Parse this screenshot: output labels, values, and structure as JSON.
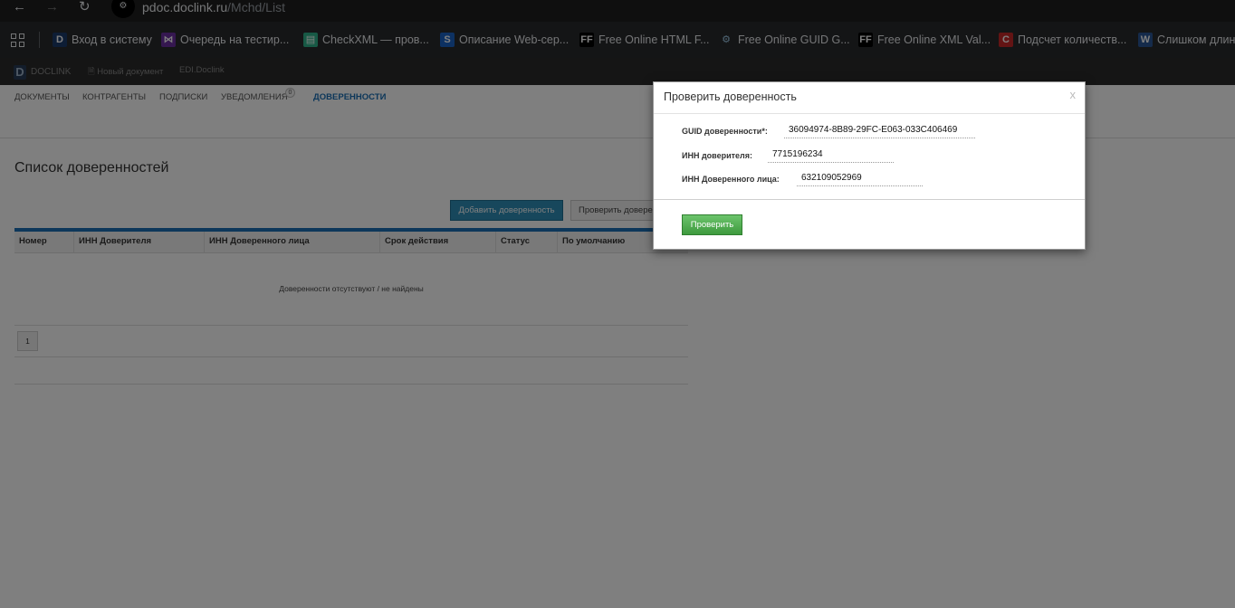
{
  "browser": {
    "url_host": "pdoc.doclink.ru",
    "url_path": "/Mchd/List",
    "bookmarks": [
      {
        "label": "Вход в систему",
        "icon": "D",
        "color": "#1a3a6b",
        "fg": "#ffffff"
      },
      {
        "label": "Очередь на тестир...",
        "icon": "⋈",
        "color": "#6b2fa0",
        "fg": "#ffffff"
      },
      {
        "label": "CheckXML — пров...",
        "icon": "▤",
        "color": "#2fb38a",
        "fg": "#ffffff"
      },
      {
        "label": "Описание Web-сер...",
        "icon": "S",
        "color": "#1b63c4",
        "fg": "#ffffff"
      },
      {
        "label": "Free Online HTML F...",
        "icon": "FF",
        "color": "#000000",
        "fg": "#ffffff"
      },
      {
        "label": "Free Online GUID G...",
        "icon": "⚙",
        "color": "#292a2d",
        "fg": "#9ecbe8"
      },
      {
        "label": "Free Online XML Val...",
        "icon": "FF",
        "color": "#000000",
        "fg": "#ffffff"
      },
      {
        "label": "Подсчет количеств...",
        "icon": "C",
        "color": "#c62828",
        "fg": "#ffffff"
      },
      {
        "label": "Слишком длинн",
        "icon": "W",
        "color": "#2b5797",
        "fg": "#ffffff"
      }
    ]
  },
  "app": {
    "logo_text": "DOCLINK",
    "new_doc": "Новый документ",
    "edi": "EDI.Doclink"
  },
  "nav": {
    "items": [
      "ДОКУМЕНТЫ",
      "КОНТРАГЕНТЫ",
      "ПОДПИСКИ",
      "УВЕДОМЛЕНИЯ",
      "ДОВЕРЕННОСТИ"
    ],
    "badge": "0"
  },
  "main": {
    "title": "Список доверенностей",
    "add_button": "Добавить доверенность",
    "check_button": "Проверить доверенность",
    "columns": [
      "Номер",
      "ИНН Доверителя",
      "ИНН Доверенного лица",
      "Срок действия",
      "Статус",
      "По умолчанию"
    ],
    "empty_text": "Доверенности отсутствуют / не найдены",
    "page": "1"
  },
  "modal": {
    "title": "Проверить доверенность",
    "close": "x",
    "guid_label": "GUID доверенности*:",
    "guid_value": "36094974-8B89-29FC-E063-033C406469",
    "inn_principal_label": "ИНН доверителя:",
    "inn_principal_value": "7715196234",
    "inn_agent_label": "ИНН Доверенного лица:",
    "inn_agent_value": "632109052969",
    "verify_button": "Проверить"
  }
}
